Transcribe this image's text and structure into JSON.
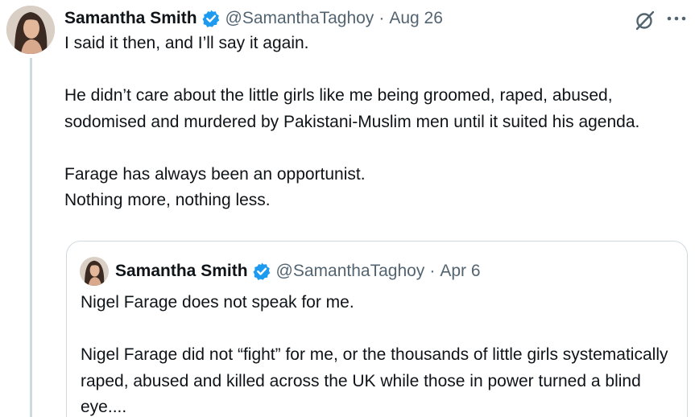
{
  "tweet": {
    "author_name": "Samantha Smith",
    "handle": "@SamanthaTaghoy",
    "separator": "·",
    "date": "Aug 26",
    "avatar_icon": "profile-photo",
    "verified_icon": "verified-badge-icon",
    "grok_icon": "grok-icon",
    "more_icon": "more-options-icon",
    "verified_color": "#1d9bf0",
    "paragraphs": [
      "I said it then, and I’ll say it again.",
      "He didn’t care about the little girls like me being groomed, raped, abused, sodomised and murdered by Pakistani-Muslim men until it suited his agenda.",
      "Farage has always been an opportunist.",
      "Nothing more, nothing less."
    ]
  },
  "quoted_tweet": {
    "author_name": "Samantha Smith",
    "handle": "@SamanthaTaghoy",
    "separator": "·",
    "date": "Apr 6",
    "paragraphs": [
      "Nigel Farage does not speak for me.",
      "Nigel Farage did not “fight” for me, or the thousands of little girls systematically raped, abused and killed across the UK while those in power turned a blind eye...."
    ]
  }
}
